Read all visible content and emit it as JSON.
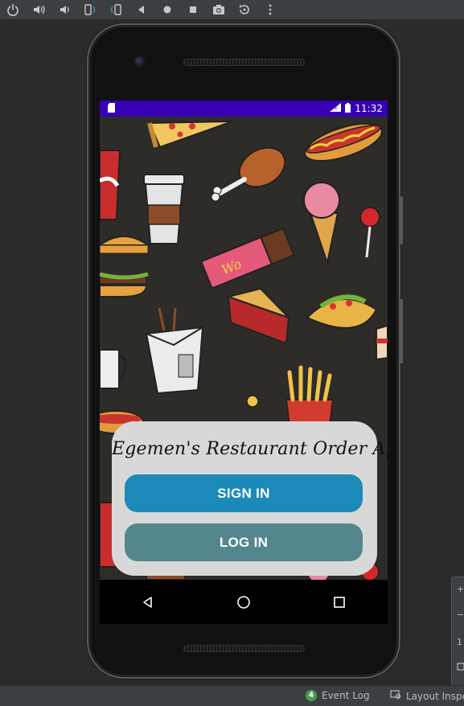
{
  "toolbar": {
    "icons": [
      "power-icon",
      "volume-up-icon",
      "volume-down-icon",
      "rotate-left-icon",
      "rotate-right-icon",
      "back-icon",
      "home-icon",
      "overview-icon",
      "camera-icon",
      "replay-icon",
      "more-icon"
    ]
  },
  "statusbar": {
    "time": "11:32",
    "color": "#3700b3"
  },
  "app": {
    "title": "Egemen's Restaurant Order App",
    "sign_in_label": "SIGN IN",
    "log_in_label": "LOG IN",
    "sign_in_color": "#1b8ab8",
    "log_in_color": "#54878d",
    "card_color": "#d8d8d8"
  },
  "ide_bottom": {
    "event_log_count": "4",
    "event_log_label": "Event Log",
    "layout_inspector_label": "Layout Inspe"
  },
  "zoom_panel": {
    "zoom_in": "+",
    "zoom_out": "−",
    "ratio": "1"
  }
}
